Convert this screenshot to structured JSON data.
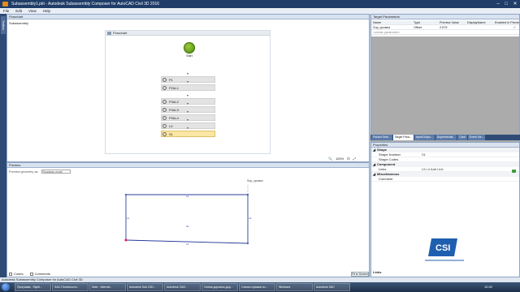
{
  "window": {
    "title": "Subassembly1.pkt - Autodesk Subassembly Composer for AutoCAD Civil 3D 2016",
    "minimize": "–",
    "maximize": "□",
    "close": "✕"
  },
  "menu": [
    "File",
    "Edit",
    "View",
    "Help"
  ],
  "toolbox": {
    "label": "Toolbox"
  },
  "flowchart": {
    "panel_title": "Flowchart",
    "path": "Subassembly",
    "canvas_title": "Flowchart",
    "start_label": "Start",
    "steps": [
      {
        "label": "P1",
        "selected": false
      },
      {
        "label": "P2&L1",
        "selected": false
      },
      {
        "label": "P3&L2",
        "selected": false
      },
      {
        "label": "P4&L3",
        "selected": false
      },
      {
        "label": "P5&L4",
        "selected": false
      },
      {
        "label": "L5",
        "selected": false
      },
      {
        "label": "S1",
        "selected": true
      }
    ],
    "zoom": "100%"
  },
  "preview": {
    "panel_title": "Preview",
    "toolbar_label": "Preview geometry as:",
    "mode": "Roadway mode",
    "target_label": "Sup_кромка",
    "codes_label": "Codes",
    "comments_label": "Comments",
    "fit_button": "Fit to Screen"
  },
  "target_parameters": {
    "panel_title": "Target Parameters",
    "columns": [
      "Name",
      "Type",
      "Preview Value",
      "DisplayName",
      "Enabled In Preview"
    ],
    "rows": [
      {
        "name": "Sup_кромка",
        "type": "Offset",
        "preview_value": "2.675",
        "display_name": "",
        "enabled": "✓"
      }
    ],
    "create_placeholder": "<create parameter>"
  },
  "tabs": [
    "Packet Setti...",
    "Target Para...",
    "Input/Outpu...",
    "Superelevati...",
    "Cant",
    "Event Vie..."
  ],
  "active_tab": 1,
  "properties": {
    "panel_title": "Properties",
    "categories": [
      {
        "name": "Shape",
        "rows": [
          {
            "name": "Shape Number",
            "value": "S1"
          },
          {
            "name": "Shape Codes",
            "value": ""
          }
        ]
      },
      {
        "name": "Component",
        "rows": [
          {
            "name": "Links",
            "value": "L5  L4   Add Link"
          }
        ]
      },
      {
        "name": "Miscellaneous",
        "rows": [
          {
            "name": "Comment",
            "value": ""
          }
        ]
      }
    ],
    "links_label": "Links"
  },
  "status": {
    "text": "Autodesk Subassembly Composer for AutoCAD Civil 3D"
  },
  "taskbar": {
    "items": [
      "Программ - Stylel...",
      "SAC-Полезности...",
      "Note - Internet...",
      "Autodesk Sub C3D...",
      "Autodesk Ctrl2...",
      "Схема дорожно-дор...",
      "Схема отрывки со...",
      "Windows",
      "Autodesk SAC"
    ],
    "clock": "10:32"
  },
  "colors": {
    "accent": "#1f3d68",
    "selected_step": "#fbe6a4",
    "start_node": "#6aa51b"
  }
}
